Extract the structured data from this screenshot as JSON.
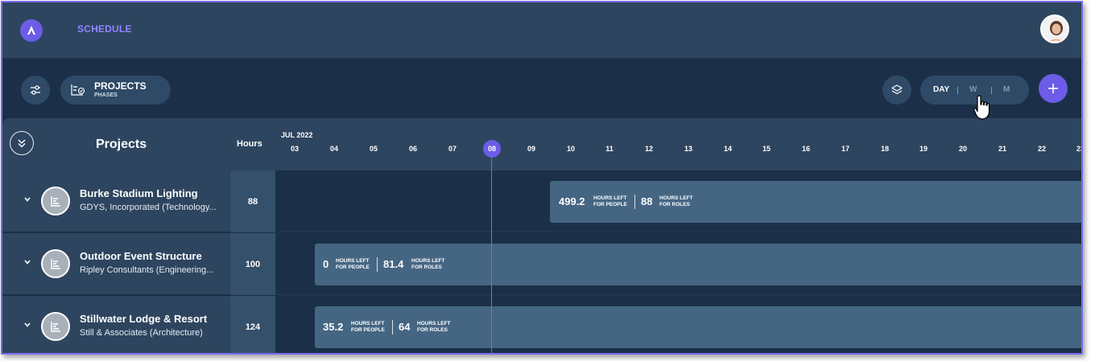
{
  "app": {
    "title": "SCHEDULE"
  },
  "toolbar": {
    "projects_label": "PROJECTS",
    "phases_label": "PHASES",
    "view_day": "DAY",
    "view_week": "W",
    "view_month": "M"
  },
  "grid": {
    "col_projects": "Projects",
    "col_hours": "Hours",
    "month": "JUL 2022",
    "days": [
      "03",
      "04",
      "05",
      "06",
      "07",
      "08",
      "09",
      "10",
      "11",
      "12",
      "13",
      "14",
      "15",
      "16",
      "17",
      "18",
      "19",
      "20",
      "21",
      "22",
      "23"
    ],
    "today": "08"
  },
  "projects": [
    {
      "name": "Burke Stadium Lighting",
      "client": "GDYS, Incorporated (Technology...",
      "hours": "88",
      "people_hours": "499.2",
      "roles_hours": "88",
      "people_label_1": "HOURS LEFT",
      "people_label_2": "FOR PEOPLE",
      "roles_label_1": "HOURS LEFT",
      "roles_label_2": "FOR ROLES"
    },
    {
      "name": "Outdoor Event Structure",
      "client": "Ripley Consultants (Engineering...",
      "hours": "100",
      "people_hours": "0",
      "roles_hours": "81.4",
      "people_label_1": "HOURS LEFT",
      "people_label_2": "FOR PEOPLE",
      "roles_label_1": "HOURS LEFT",
      "roles_label_2": "FOR ROLES"
    },
    {
      "name": "Stillwater Lodge & Resort",
      "client": "Still & Associates (Architecture)",
      "hours": "124",
      "people_hours": "35.2",
      "roles_hours": "64",
      "people_label_1": "HOURS LEFT",
      "people_label_2": "FOR PEOPLE",
      "roles_label_1": "HOURS LEFT",
      "roles_label_2": "FOR ROLES"
    }
  ]
}
